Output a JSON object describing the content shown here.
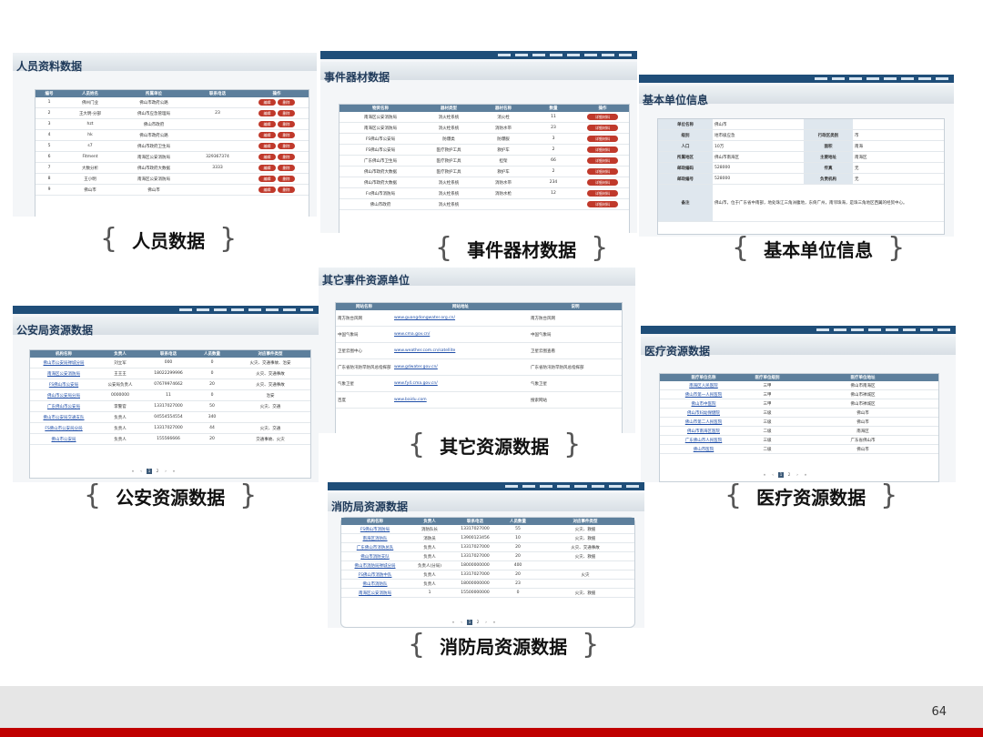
{
  "captions": {
    "personnel": "人员数据",
    "equipment": "事件器材数据",
    "unit": "基本单位信息",
    "other": "其它资源数据",
    "police": "公安资源数据",
    "medical": "医疗资源数据",
    "fire": "消防局资源数据"
  },
  "panels": {
    "personnel": {
      "title": "人员资料数据",
      "headers": [
        "编号",
        "人员姓名",
        "所属单位",
        "联系电话",
        "操作"
      ],
      "rows": [
        [
          "1",
          "佛州门业",
          "佛山市政府公路",
          "",
          ""
        ],
        [
          "2",
          "王大明-分部",
          "佛山市应急管理局",
          "23",
          ""
        ],
        [
          "3",
          "hzt",
          "佛山市政府",
          "",
          ""
        ],
        [
          "4",
          "hk",
          "佛山市政府公路",
          "",
          ""
        ],
        [
          "5",
          "s7",
          "佛山市政府卫生局",
          "",
          ""
        ],
        [
          "6",
          "Fitment",
          "南海区公安消防局",
          "329367374",
          ""
        ],
        [
          "7",
          "大数分析",
          "佛山市政府大数据",
          "3333",
          ""
        ],
        [
          "8",
          "王小明",
          "南海区公安消防局",
          "",
          ""
        ],
        [
          "9",
          "佛山市",
          "佛山市",
          "",
          ""
        ]
      ],
      "actions": [
        "编辑",
        "删除"
      ]
    },
    "equipment": {
      "title": "事件器材数据",
      "headers": [
        "物资名称",
        "器材类型",
        "器材名称",
        "数量",
        "操作"
      ],
      "rows": [
        [
          "南海区公安消防局",
          "消火栓系统",
          "消火栓",
          "11"
        ],
        [
          "南海区公安消防局",
          "消火栓系统",
          "消防水带",
          "23"
        ],
        [
          "FS佛山市公安局",
          "防爆类",
          "防爆服",
          "3"
        ],
        [
          "FS佛山市公安局",
          "医疗救护工具",
          "救护车",
          "2"
        ],
        [
          "广东佛山市卫生局",
          "医疗救护工具",
          "担架",
          "66"
        ],
        [
          "佛山市政府大数据",
          "医疗救护工具",
          "救护车",
          "2"
        ],
        [
          "佛山市政府大数据",
          "消火栓系统",
          "消防水带",
          "234"
        ],
        [
          "Fs佛山市消防局",
          "消火栓系统",
          "消防水枪",
          "12"
        ],
        [
          "佛山市政府",
          "消火栓系统",
          "",
          ""
        ]
      ],
      "action": "详细材料"
    },
    "unit": {
      "title": "基本单位信息",
      "fields": [
        [
          "单位名称",
          "佛山市",
          "",
          ""
        ],
        [
          "级别",
          "地市级应急",
          "行政区类别",
          "市"
        ],
        [
          "人口",
          "10万",
          "面积",
          "南海"
        ],
        [
          "所属地区",
          "佛山市南海区",
          "主要地址",
          "南海区"
        ],
        [
          "邮政编码",
          "528000",
          "传真",
          "无"
        ],
        [
          "邮政编号",
          "528000",
          "负责机构",
          "无"
        ]
      ],
      "remark_label": "备注",
      "remark": "佛山市，位于广东省中南部，地处珠江三角洲腹地，东倚广州，南邻珠海，是珠三角地区西翼的经贸中心。"
    },
    "other": {
      "title": "其它事件资源单位",
      "headers": [
        "网站名称",
        "网站地址",
        "说明"
      ],
      "rows": [
        [
          "南方防台风网",
          "www.guangdongwater.org.cn/",
          "南方防台风网"
        ],
        [
          "中国气象局",
          "www.cma.gov.cn/",
          "中国气象局"
        ],
        [
          "卫星云图中心",
          "www.weather.com.cn/satellite",
          "卫星云图查看"
        ],
        [
          "广东省防汛防旱防风总指挥部",
          "www.gdwater.gov.cn/",
          "广东省防汛防旱防风总指挥部"
        ],
        [
          "气象卫星",
          "www.fy4.cma.gov.cn/",
          "气象卫星"
        ],
        [
          "百度",
          "www.baidu.com",
          "搜索网站"
        ]
      ]
    },
    "police": {
      "title": "公安局资源数据",
      "headers": [
        "机构名称",
        "负责人",
        "联系电话",
        "人员数量",
        "对应事件类型"
      ],
      "rows": [
        [
          "佛山市公安局禅城分局",
          "刘立军",
          "000",
          "0",
          "火灾、交通事故、治安"
        ],
        [
          "南海区公安消防局",
          "王王王",
          "18022299996",
          "0",
          "火灾、交通事故"
        ],
        [
          "FS佛山市公安局",
          "公安局负责人",
          "07679974662",
          "20",
          "火灾、交通事故"
        ],
        [
          "佛山市公安局分局",
          "0000000",
          "11",
          "0",
          "治安"
        ],
        [
          "广东佛山市公安局",
          "李警官",
          "13317027000",
          "50",
          "火灾、交通"
        ],
        [
          "佛山市公安局交通支队",
          "负责人",
          "04554554554",
          "340",
          ""
        ],
        [
          "FS佛山市公安局分局",
          "负责人",
          "13317027000",
          "44",
          "火灾、交通"
        ],
        [
          "佛山市公安局",
          "负责人",
          "155566666",
          "20",
          "交通事故、火灾"
        ]
      ],
      "pager": [
        "«",
        "‹",
        "1",
        "2",
        "›",
        "»"
      ]
    },
    "medical": {
      "title": "医疗资源数据",
      "headers": [
        "医疗单位名称",
        "医疗单位级别",
        "医疗单位地址"
      ],
      "rows": [
        [
          "南海区人民医院",
          "三甲",
          "佛山市南海区"
        ],
        [
          "佛山市第一人民医院",
          "三甲",
          "佛山市禅城区"
        ],
        [
          "佛山市中医院",
          "三甲",
          "佛山市禅城区"
        ],
        [
          "佛山市妇幼保健院",
          "三级",
          "佛山市"
        ],
        [
          "佛山市第二人民医院",
          "三级",
          "佛山市"
        ],
        [
          "佛山市南海区医院",
          "二级",
          "南海区"
        ],
        [
          "广东佛山市人民医院",
          "三级",
          "广东省佛山市"
        ],
        [
          "佛山市医院",
          "二级",
          "佛山市"
        ]
      ],
      "pager": [
        "«",
        "‹",
        "1",
        "2",
        "›",
        "»"
      ]
    },
    "fire": {
      "title": "消防局资源数据",
      "headers": [
        "机构名称",
        "负责人",
        "联系电话",
        "人员数量",
        "对应事件类型"
      ],
      "rows": [
        [
          "FS佛山市消防局",
          "消防队长",
          "13317027000",
          "55",
          "火灾、救援"
        ],
        [
          "南海区消防队",
          "消防员",
          "13900123456",
          "10",
          "火灾、救援"
        ],
        [
          "广东佛山市消防总队",
          "负责人",
          "13317027000",
          "20",
          "火灾、交通事故"
        ],
        [
          "佛山市消防支队",
          "负责人",
          "13317027000",
          "20",
          "火灾、救援"
        ],
        [
          "佛山市消防局禅城分局",
          "负责人(分局)",
          "18000000000",
          "400",
          ""
        ],
        [
          "FS佛山市消防中队",
          "负责人",
          "13317027000",
          "20",
          "火灾"
        ],
        [
          "佛山市消防队",
          "负责人",
          "18000000000",
          "23",
          ""
        ],
        [
          "南海区公安消防局",
          "1",
          "15500000000",
          "0",
          "火灾、救援"
        ]
      ],
      "pager": [
        "«",
        "‹",
        "1",
        "2",
        "›",
        "»"
      ]
    }
  },
  "footer": {
    "page_number": "64"
  },
  "colors": {
    "header": "#5d7f9c",
    "nav": "#1f4e79",
    "button": "#c0392b",
    "footer_red": "#c00000"
  }
}
